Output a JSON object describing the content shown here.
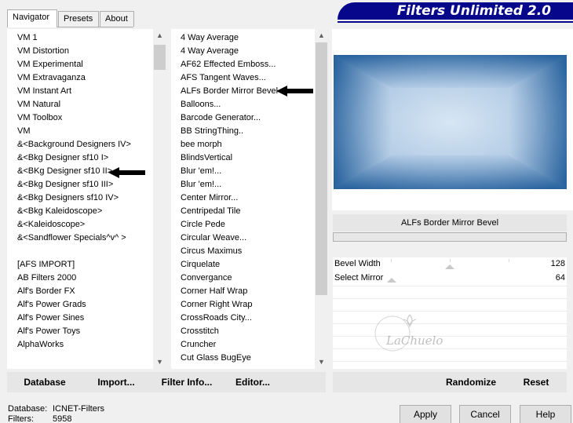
{
  "tabs": [
    {
      "label": "Navigator",
      "active": true
    },
    {
      "label": "Presets",
      "active": false
    },
    {
      "label": "About",
      "active": false
    }
  ],
  "title": "Filters Unlimited 2.0",
  "categories": [
    "VM 1",
    "VM Distortion",
    "VM Experimental",
    "VM Extravaganza",
    "VM Instant Art",
    "VM Natural",
    "VM Toolbox",
    "VM",
    "&<Background Designers IV>",
    "&<Bkg Designer sf10 I>",
    "&<BKg Designer sf10 II>",
    "&<Bkg Designer sf10 III>",
    "&<Bkg Designers sf10 IV>",
    "&<Bkg Kaleidoscope>",
    "&<Kaleidoscope>",
    "&<Sandflower Specials^v^ >",
    "",
    "[AFS IMPORT]",
    "AB Filters 2000",
    "Alf's Border FX",
    "Alf's Power Grads",
    "Alf's Power Sines",
    "Alf's Power Toys",
    "AlphaWorks"
  ],
  "filters": [
    "4 Way Average",
    "4 Way Average",
    "AF62 Effected Emboss...",
    "AFS Tangent Waves...",
    "ALFs Border Mirror Bevel",
    "Balloons...",
    "Barcode Generator...",
    "BB StringThing..",
    "bee morph",
    "BlindsVertical",
    "Blur 'em!...",
    "Blur 'em!...",
    "Center Mirror...",
    "Centripedal Tile",
    "Circle Pede",
    "Circular Weave...",
    "Circus Maximus",
    "Cirquelate",
    "Convergance",
    "Corner Half Wrap",
    "Corner Right Wrap",
    "CrossRoads City...",
    "Crosstitch",
    "Cruncher",
    "Cut Glass  BugEye"
  ],
  "left_buttons": {
    "database": "Database",
    "import": "Import...",
    "filter_info": "Filter Info...",
    "editor": "Editor..."
  },
  "selected_filter": "ALFs Border Mirror Bevel",
  "params": [
    {
      "label": "Bevel Width",
      "value": "128",
      "level": 0.5
    },
    {
      "label": "Select Mirror",
      "value": "64",
      "level": 0.25
    }
  ],
  "right_buttons": {
    "randomize": "Randomize",
    "reset": "Reset"
  },
  "status": {
    "db_label": "Database:",
    "db_value": "ICNET-Filters",
    "filters_label": "Filters:",
    "filters_value": "5958"
  },
  "dialog_buttons": {
    "apply": "Apply",
    "cancel": "Cancel",
    "help": "Help"
  },
  "watermark_text": "LaChuelo",
  "colors": {
    "banner": "#07078c",
    "preview_light": "#e8f0f8",
    "preview_dark": "#1e5a96"
  }
}
